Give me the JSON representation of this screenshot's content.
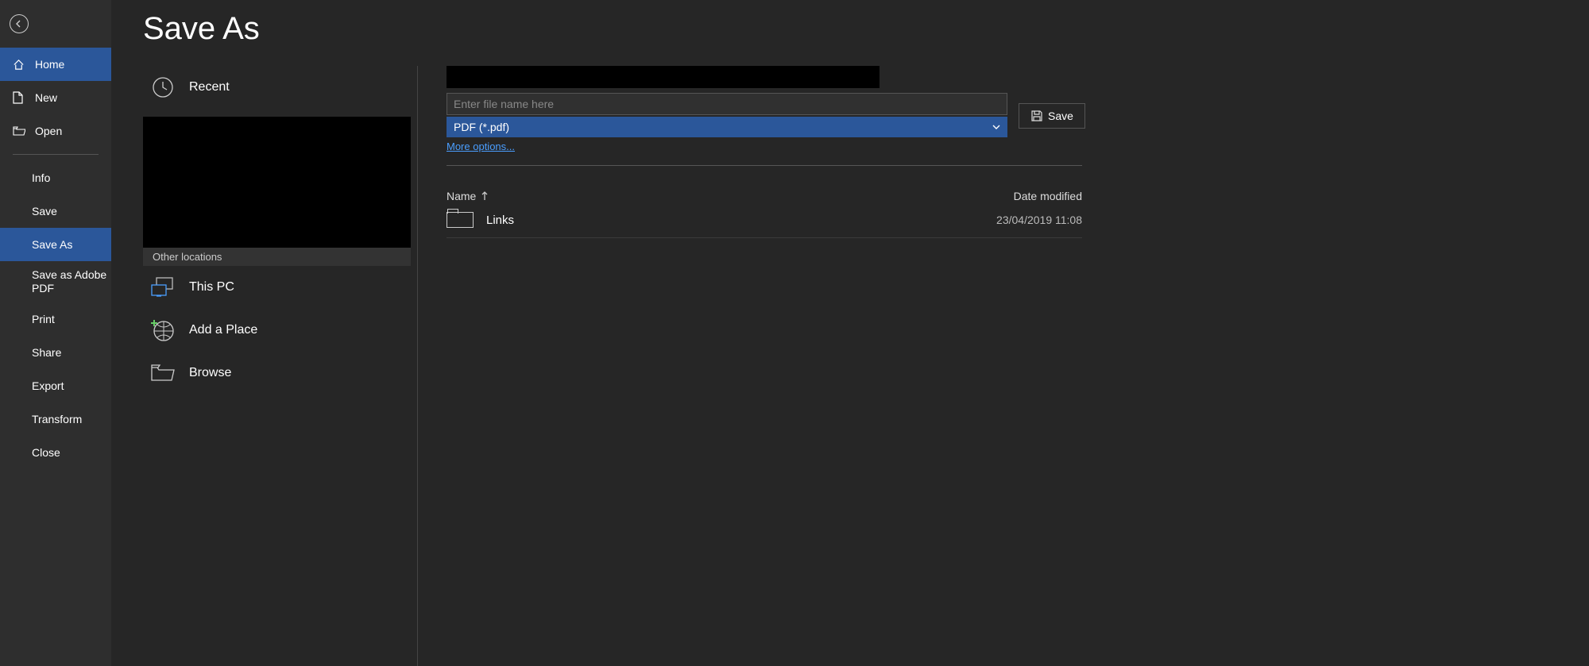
{
  "page_title": "Save As",
  "sidebar": {
    "home": "Home",
    "new": "New",
    "open": "Open",
    "info": "Info",
    "save": "Save",
    "save_as": "Save As",
    "save_as_adobe": "Save as Adobe PDF",
    "print": "Print",
    "share": "Share",
    "export": "Export",
    "transform": "Transform",
    "close": "Close"
  },
  "locations": {
    "recent": "Recent",
    "other_label": "Other locations",
    "this_pc": "This PC",
    "add_place": "Add a Place",
    "browse": "Browse"
  },
  "detail": {
    "filename_placeholder": "Enter file name here",
    "file_type": "PDF (*.pdf)",
    "more_options": "More options...",
    "save_button": "Save",
    "col_name": "Name",
    "col_date": "Date modified",
    "rows": [
      {
        "name": "Links",
        "date": "23/04/2019 11:08"
      }
    ]
  }
}
